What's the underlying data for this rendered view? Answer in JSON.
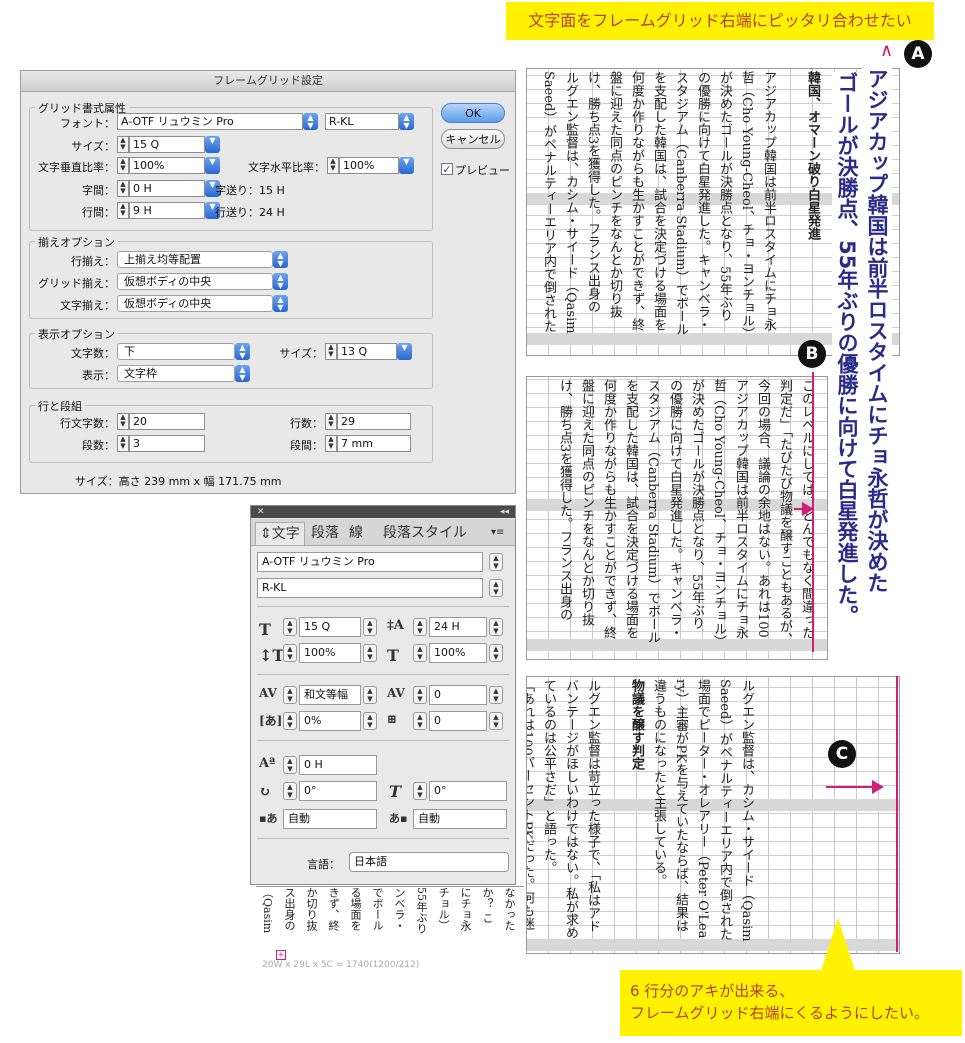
{
  "callouts": {
    "top": "文字面をフレームグリッド右端にピッタリ合わせたい",
    "bottom_line1": "6 行分のアキが出来る、",
    "bottom_line2": "フレームグリッド右端にくるようにしたい。"
  },
  "markers": {
    "a": "A",
    "b": "B",
    "c": "C",
    "caret": "∧"
  },
  "colors": {
    "callout_bg": "#fff200",
    "callout_text": "#b0421f",
    "accent_pink": "#d21e7b",
    "headline": "#2b2b8a"
  },
  "article": {
    "headline1": "アジアカップ韓国は前半ロスタイムにチョ永哲が決めた",
    "headline2": "ゴールが決勝点、55年ぶりの優勝に向けて白星発進した。",
    "frame1_cols": [
      "韓国、オマーン破り白星発進",
      "アジアカップ韓国は前半ロスタイムにチョ永",
      "哲（Cho Young-Cheol、チョ・ヨンチョル）",
      "が決めたゴールが決勝点となり、55年ぶり",
      "の優勝に向けて白星発進した。キャンベラ・",
      "スタジアム（Canberra Stadium）でボール",
      "を支配した韓国は、試合を決定づける場面を",
      "何度か作りながらも生かすことができず、終",
      "盤に迎えた同点のピンチをなんとか切り抜",
      "け、勝ち点3を獲得した。フランス出身の",
      "ルグエン監督は、カシム・サイード（Qasim",
      "Saeed）がペナルティーエリア内で倒された"
    ],
    "frame2_cols": [
      "このレベルにしては、とんでもなく間違った",
      "判定だ」「たびたび物議を醸すこともあるが、",
      "今回の場合、議論の余地はない。あれは100",
      "アジアカップ韓国は前半ロスタイムにチョ永",
      "哲（Cho Young-Cheol、チョ・ヨンチョル）",
      "が決めたゴールが決勝点となり、55年ぶり",
      "の優勝に向けて白星発進した。キャンベラ・",
      "スタジアム（Canberra Stadium）でボール",
      "を支配した韓国は、試合を決定づける場面を",
      "何度か作りながらも生かすことができず、終",
      "盤に迎えた同点のピンチをなんとか切り抜",
      "け、勝ち点3を獲得した。フランス出身の"
    ],
    "frame3_cols": [
      "ルグエン監督は、カシム・サイード（Qasim",
      "Saeed）がペナルティーエリア内で倒された",
      "場面でピーター・オレアリー（Peter O'Lea",
      "ry）主審がPKを与えていたならば、結果は",
      "違うものになったと主張している。",
      "物議を醸す判定",
      "ルグエン監督は苛立った様子で、「私はアド",
      "バンテージがほしいわけではない。私が求め",
      "ているのは公平さだ」と語った。",
      "「あれは100パーセントPKだった。何も迷"
    ],
    "overflow_cols": [
      "なかった",
      "か？ こ",
      "にチョ永",
      "チョル）",
      "55年ぶり",
      "ンベラ・",
      "でボール",
      "る場面を",
      "きず、終",
      "か切り抜",
      "ス出身の",
      "（Qasim"
    ],
    "overflow_note": "20W x 29L x 5C = 1740(1200/212)"
  },
  "dialog": {
    "title": "フレームグリッド設定",
    "section_grid": "グリッド書式属性",
    "font_label": "フォント：",
    "font_value": "A-OTF リュウミン Pro",
    "font_style": "R-KL",
    "size_label": "サイズ：",
    "size_value": "15 Q",
    "vscale_label": "文字垂直比率：",
    "vscale_value": "100%",
    "hscale_label": "文字水平比率：",
    "hscale_value": "100%",
    "char_space_label": "字間：",
    "char_space_value": "0 H",
    "char_pitch": "字送り：15 H",
    "line_space_label": "行間：",
    "line_space_value": "9 H",
    "line_pitch": "行送り：24 H",
    "section_align": "揃えオプション",
    "line_align_label": "行揃え：",
    "line_align_value": "上揃え均等配置",
    "grid_align_label": "グリッド揃え：",
    "grid_align_value": "仮想ボディの中央",
    "char_align_label": "文字揃え：",
    "char_align_value": "仮想ボディの中央",
    "section_view": "表示オプション",
    "count_label": "文字数：",
    "count_value": "下",
    "count_size_label": "サイズ：",
    "count_size_value": "13 Q",
    "view_label": "表示：",
    "view_value": "文字枠",
    "section_lines": "行と段組",
    "chars_per_line_label": "行文字数：",
    "chars_per_line_value": "20",
    "lines_label": "行数：",
    "lines_value": "29",
    "columns_label": "段数：",
    "columns_value": "3",
    "gutter_label": "段間：",
    "gutter_value": "7 mm",
    "size_summary": "サイズ：高さ 239 mm x 幅 171.75 mm",
    "ok": "OK",
    "cancel": "キャンセル",
    "preview": "プレビュー"
  },
  "panel": {
    "tab_char": "文字",
    "tab_para": "段落",
    "tab_line": "線",
    "tab_parastyle": "段落スタイル",
    "font_value": "A-OTF リュウミン Pro",
    "style_value": "R-KL",
    "size_value": "15 Q",
    "leading_value": "24 H",
    "vscale_value": "100%",
    "hscale_value": "100%",
    "kerning_value": "和文等幅",
    "tracking_value": "0",
    "tsume_value": "0%",
    "aki_value": "0",
    "baseline_value": "0 H",
    "rotation_value": "0°",
    "skew_value": "0°",
    "aki_before": "自動",
    "aki_after": "自動",
    "language_label": "言語：",
    "language_value": "日本語"
  }
}
